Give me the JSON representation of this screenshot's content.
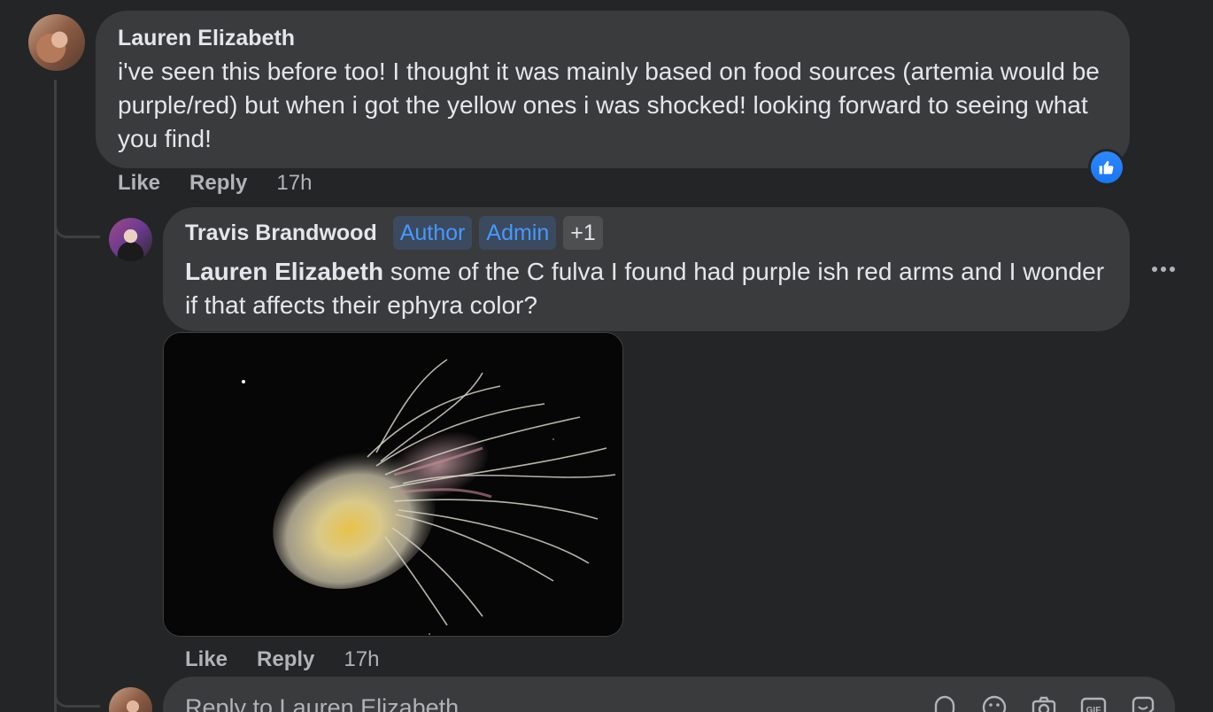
{
  "comments": [
    {
      "author": "Lauren Elizabeth",
      "text": "i've seen this before too! I thought it was mainly based on food sources (artemia would be purple/red) but when i got the yellow ones i was shocked! looking forward to seeing what you find!",
      "actions": {
        "like": "Like",
        "reply": "Reply",
        "time": "17h"
      },
      "reaction_icon": "like-icon",
      "reaction_color": "#1877f2"
    },
    {
      "author": "Travis Brandwood",
      "badges": [
        "Author",
        "Admin",
        "+1"
      ],
      "mention": "Lauren Elizabeth",
      "text": " some of the C fulva I found had purple ish red arms and I wonder if that affects their ephyra color?",
      "attachment_icon": "jellyfish-photo",
      "actions": {
        "like": "Like",
        "reply": "Reply",
        "time": "17h"
      }
    }
  ],
  "composer": {
    "placeholder": "Reply to Lauren Elizabeth",
    "icons": [
      "sticker-icon",
      "emoji-icon",
      "camera-icon",
      "gif-icon",
      "avatar-sticker-icon"
    ]
  },
  "colors": {
    "background": "#242526",
    "bubble": "#3a3b3c",
    "badge_text": "#4599ff",
    "secondary_text": "#b0b3b8"
  }
}
